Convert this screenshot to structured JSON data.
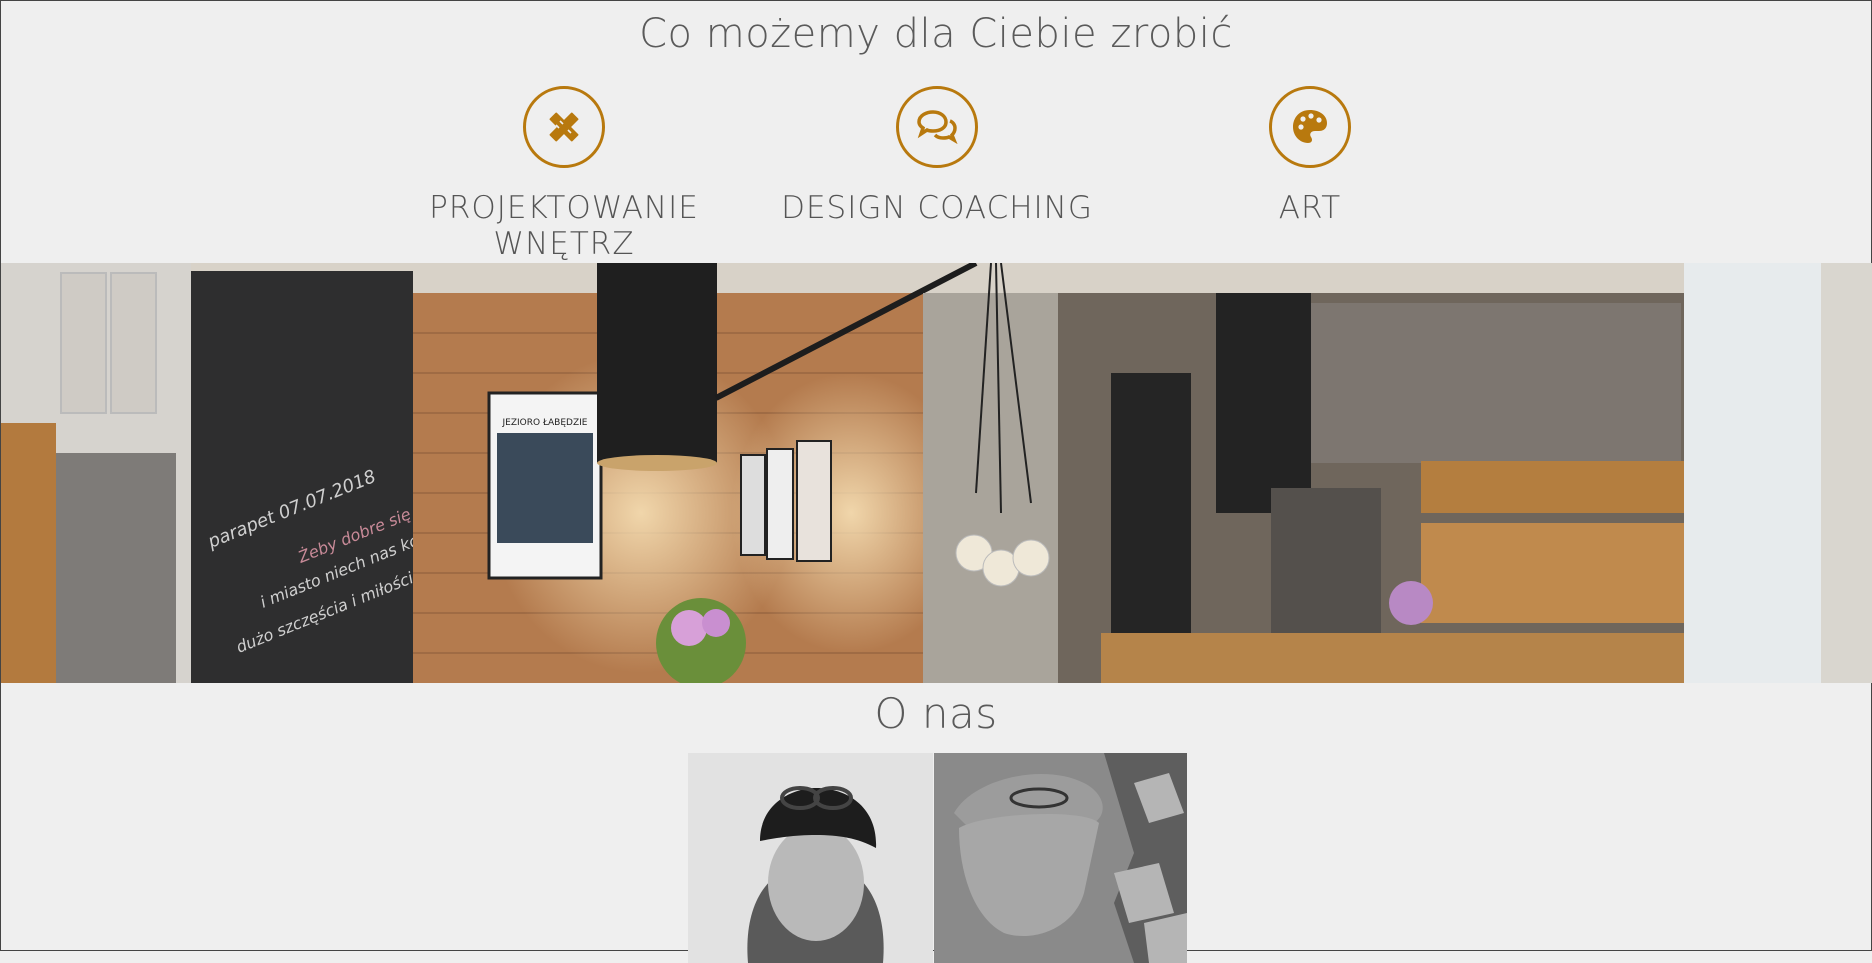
{
  "services": {
    "title": "Co możemy dla Ciebie zrobić",
    "items": [
      {
        "label": "PROJEKTOWANIE WNĘTRZ",
        "icon": "pencil-ruler-icon"
      },
      {
        "label": "DESIGN COACHING",
        "icon": "chat-bubbles-icon"
      },
      {
        "label": "ART",
        "icon": "palette-icon"
      }
    ]
  },
  "hero": {
    "chalkboard_text": [
      "parapet 07.07.2018",
      "Żeby dobre się nie kończyło!",
      "i miasto niech nas kochało :)",
      "dużo szczęścia i miłości :)"
    ],
    "poster_title": "JEZIORO ŁABĘDZIE"
  },
  "about": {
    "title": "O nas"
  },
  "colors": {
    "accent": "#b8790e",
    "background": "#efefef"
  }
}
